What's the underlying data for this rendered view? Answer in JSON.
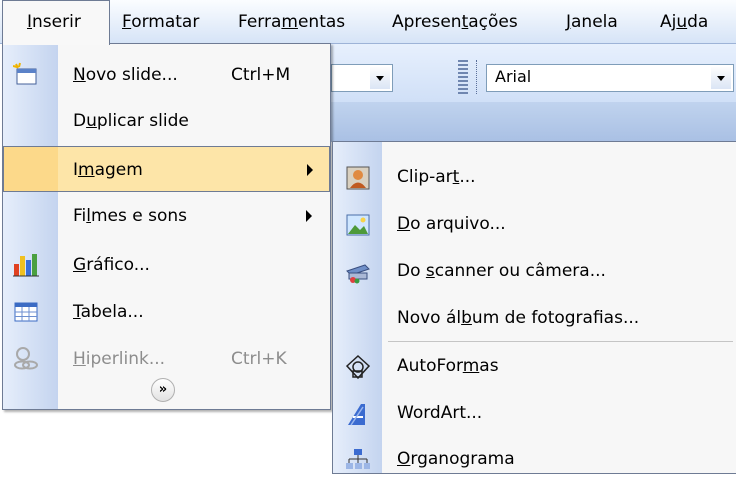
{
  "menubar": {
    "items": [
      {
        "pre": "",
        "ul": "I",
        "post": "nserir"
      },
      {
        "pre": "",
        "ul": "F",
        "post": "ormatar"
      },
      {
        "pre": "Ferra",
        "ul": "m",
        "post": "entas"
      },
      {
        "pre": "Apresen",
        "ul": "t",
        "post": "ações"
      },
      {
        "pre": "",
        "ul": "J",
        "post": "anela"
      },
      {
        "pre": "Aj",
        "ul": "u",
        "post": "da"
      }
    ]
  },
  "toolbar": {
    "font_name": "Arial"
  },
  "main_menu": {
    "items": [
      {
        "pre": "",
        "ul": "N",
        "post": "ovo slide...",
        "shortcut": "Ctrl+M",
        "icon": "new-slide-icon"
      },
      {
        "pre": "D",
        "ul": "u",
        "post": "plicar slide",
        "shortcut": "",
        "icon": ""
      },
      {
        "pre": "I",
        "ul": "m",
        "post": "agem",
        "shortcut": "",
        "icon": "",
        "submenu": true,
        "highlighted": true
      },
      {
        "pre": "Fi",
        "ul": "l",
        "post": "mes e sons",
        "shortcut": "",
        "icon": "",
        "submenu": true
      },
      {
        "pre": "",
        "ul": "G",
        "post": "ráfico...",
        "shortcut": "",
        "icon": "chart-icon"
      },
      {
        "pre": "",
        "ul": "T",
        "post": "abela...",
        "shortcut": "",
        "icon": "table-icon"
      },
      {
        "pre": "",
        "ul": "H",
        "post": "iperlink...",
        "shortcut": "Ctrl+K",
        "icon": "hyperlink-icon",
        "disabled": true
      }
    ],
    "expand_glyph": "»"
  },
  "sub_menu": {
    "items": [
      {
        "pre": "Clip-ar",
        "ul": "t",
        "post": "...",
        "icon": "clip-art-icon"
      },
      {
        "pre": "",
        "ul": "D",
        "post": "o arquivo...",
        "icon": "from-file-icon"
      },
      {
        "pre": "Do ",
        "ul": "s",
        "post": "canner ou câmera...",
        "icon": "scanner-camera-icon"
      },
      {
        "pre": "Novo ál",
        "ul": "b",
        "post": "um de fotografias...",
        "icon": ""
      },
      {
        "pre": "AutoFor",
        "ul": "m",
        "post": "as",
        "icon": "autoshapes-icon"
      },
      {
        "pre": "WordArt",
        "ul": "",
        "post": "...",
        "icon": "wordart-icon"
      },
      {
        "pre": "",
        "ul": "O",
        "post": "rganograma",
        "icon": "org-chart-icon"
      }
    ]
  }
}
